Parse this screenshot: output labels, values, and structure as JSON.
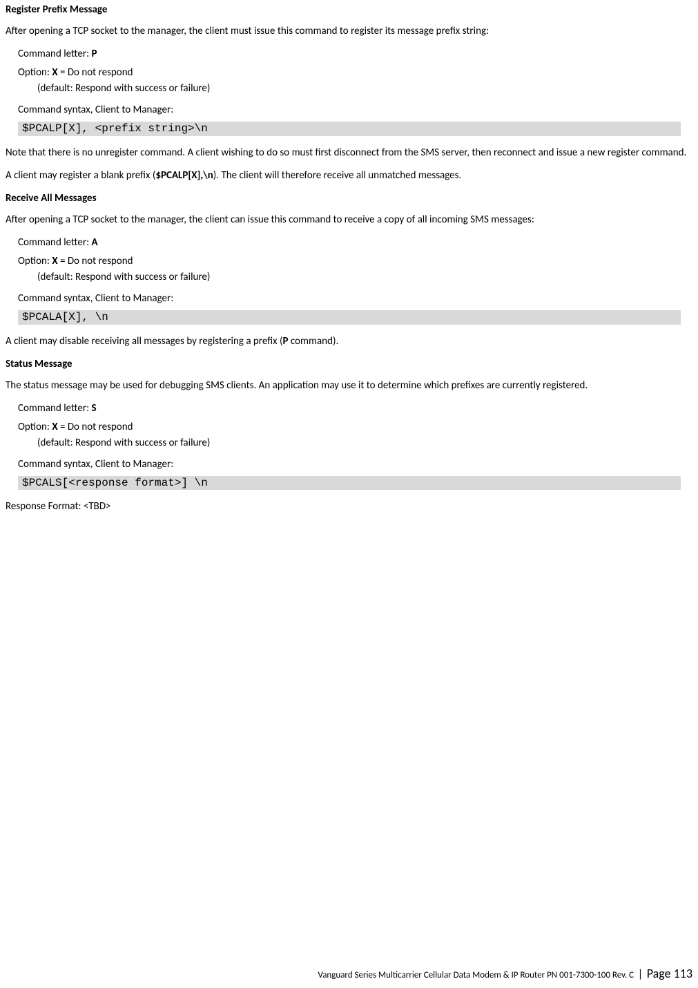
{
  "section1": {
    "heading": "Register Prefix Message",
    "intro": "After opening a TCP socket to the manager, the client must issue this command to register its message prefix string:",
    "cmd_letter_label": "Command letter: ",
    "cmd_letter": "P",
    "option_label": "Option: ",
    "option_letter": "X",
    "option_desc": " = Do not respond",
    "option_default": "(default: Respond with success or failure)",
    "syntax_label": "Command syntax, Client to Manager:",
    "code": "$PCALP[X], <prefix string>\\n",
    "note1a": "Note that there is no unregister command. A client wishing to do so must first disconnect from the SMS server, then reconnect and issue a new register command.",
    "note2_pre": "A client may register a blank prefix (",
    "note2_bold": "$PCALP[X],\\n",
    "note2_post": "). The client will therefore receive all unmatched messages."
  },
  "section2": {
    "heading": "Receive All Messages",
    "intro": "After opening a TCP socket to the manager, the client can issue this command to receive a copy of all incoming SMS messages:",
    "cmd_letter_label": "Command letter: ",
    "cmd_letter": "A",
    "option_label": "Option: ",
    "option_letter": "X",
    "option_desc": " = Do not respond",
    "option_default": "(default: Respond with success or failure)",
    "syntax_label": "Command syntax, Client to Manager:",
    "code": "$PCALA[X], \\n",
    "note_pre": "A client may disable receiving all messages by registering a prefix (",
    "note_bold": "P",
    "note_post": " command)."
  },
  "section3": {
    "heading": "Status Message",
    "intro": "The status message may be used for debugging SMS clients. An application may use it to determine which prefixes are currently registered.",
    "cmd_letter_label": "Command letter: ",
    "cmd_letter": "S",
    "option_label": "Option: ",
    "option_letter": "X",
    "option_desc": " = Do not respond",
    "option_default": "(default: Respond with success or failure)",
    "syntax_label": "Command syntax, Client to Manager:",
    "code": "$PCALS[<response format>] \\n",
    "response_format": "Response Format: <TBD>"
  },
  "footer": {
    "doc": "Vanguard Series Multicarrier Cellular Data Modem & IP Router PN 001-7300-100 Rev. C",
    "sep": " | ",
    "page_label": "Page ",
    "page_num": "113"
  }
}
